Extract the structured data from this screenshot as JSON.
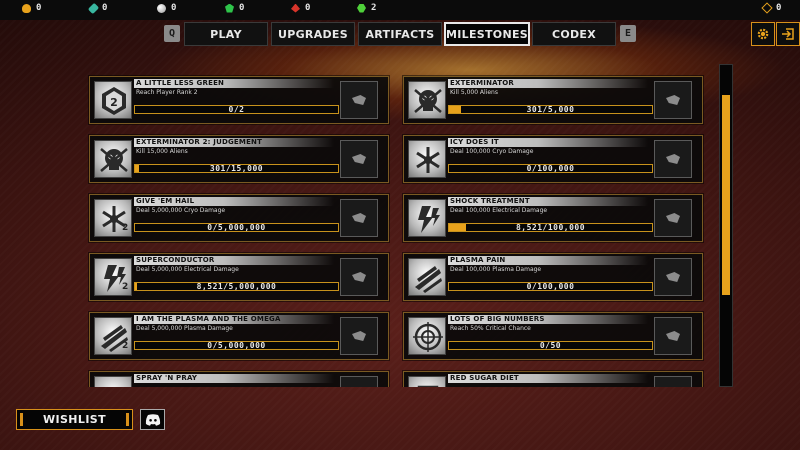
{
  "resources": [
    {
      "icon": "gold-nugget-icon",
      "value": "0"
    },
    {
      "icon": "teal-crystal-icon",
      "value": "0"
    },
    {
      "icon": "silver-orb-icon",
      "value": "0"
    },
    {
      "icon": "green-gem-icon",
      "value": "0"
    },
    {
      "icon": "red-gem-icon",
      "value": "0"
    },
    {
      "icon": "lime-crystal-icon",
      "value": "2"
    }
  ],
  "currency": {
    "icon": "coin-icon",
    "value": "0"
  },
  "keys": {
    "left": "Q",
    "right": "E"
  },
  "tabs": [
    "PLAY",
    "UPGRADES",
    "ARTIFACTS",
    "MILESTONES",
    "CODEX"
  ],
  "active_tab": "MILESTONES",
  "milestones": [
    {
      "title": "A LITTLE LESS GREEN",
      "desc": "Reach Player Rank 2",
      "progress": "0/2",
      "fraction": 0,
      "tier": ""
    },
    {
      "title": "EXTERMINATOR",
      "desc": "Kill 5,000 Aliens",
      "progress": "301/5,000",
      "fraction": 0.06,
      "tier": ""
    },
    {
      "title": "EXTERMINATOR 2: JUDGEMENT",
      "desc": "Kill 15,000 Aliens",
      "progress": "301/15,000",
      "fraction": 0.02,
      "tier": ""
    },
    {
      "title": "ICY DOES IT",
      "desc": "Deal 100,000 Cryo Damage",
      "progress": "0/100,000",
      "fraction": 0,
      "tier": ""
    },
    {
      "title": "GIVE 'EM HAIL",
      "desc": "Deal 5,000,000 Cryo Damage",
      "progress": "0/5,000,000",
      "fraction": 0,
      "tier": "2"
    },
    {
      "title": "SHOCK TREATMENT",
      "desc": "Deal 100,000 Electrical Damage",
      "progress": "8,521/100,000",
      "fraction": 0.085,
      "tier": ""
    },
    {
      "title": "SUPERCONDUCTOR",
      "desc": "Deal 5,000,000 Electrical Damage",
      "progress": "8,521/5,000,000",
      "fraction": 0.0017,
      "tier": "2"
    },
    {
      "title": "PLASMA PAIN",
      "desc": "Deal 100,000 Plasma Damage",
      "progress": "0/100,000",
      "fraction": 0,
      "tier": ""
    },
    {
      "title": "I AM THE PLASMA AND THE OMEGA",
      "desc": "Deal 5,000,000 Plasma Damage",
      "progress": "0/5,000,000",
      "fraction": 0,
      "tier": "2"
    },
    {
      "title": "LOTS OF BIG NUMBERS",
      "desc": "Reach 50% Critical Chance",
      "progress": "0/50",
      "fraction": 0,
      "tier": ""
    },
    {
      "title": "SPRAY 'N PRAY",
      "desc": "",
      "progress": "",
      "fraction": 0,
      "tier": ""
    },
    {
      "title": "RED SUGAR DIET",
      "desc": "",
      "progress": "",
      "fraction": 0,
      "tier": ""
    }
  ],
  "scroll_fraction": 0.0,
  "wishlist_label": "WISHLIST",
  "discord_icon": "discord-icon",
  "colors": {
    "accent": "#e8a21c",
    "frame": "#7a5a22"
  }
}
